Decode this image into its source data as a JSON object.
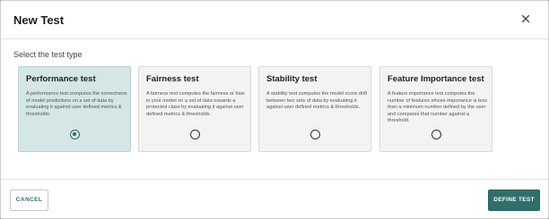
{
  "modal": {
    "title": "New Test",
    "close_icon": "close-icon"
  },
  "section": {
    "label": "Select the test type"
  },
  "cards": [
    {
      "title": "Performance test",
      "description": "A performance test computes the correctness of model predictions on a set of data by evaluating it against user defined metrics & thresholds.",
      "selected": true
    },
    {
      "title": "Fairness test",
      "description": "A fairness test computes the fairness or bias in your model on a set of data towards a protected class by evaluating it against user defined metrics & thresholds.",
      "selected": false
    },
    {
      "title": "Stability test",
      "description": "A stability test computes the model score drift between two sets of data by evaluating it against user defined metrics & thresholds.",
      "selected": false
    },
    {
      "title": "Feature Importance test",
      "description": "A feature importance test computes the number of features whose importance is less than a minimum number defined by the user and compares that number against a threshold.",
      "selected": false
    }
  ],
  "footer": {
    "cancel_label": "CANCEL",
    "define_label": "DEFINE TEST"
  },
  "colors": {
    "accent": "#2f6f6b",
    "selected_card_bg": "#d4e6e6",
    "card_bg": "#f3f3f3"
  }
}
